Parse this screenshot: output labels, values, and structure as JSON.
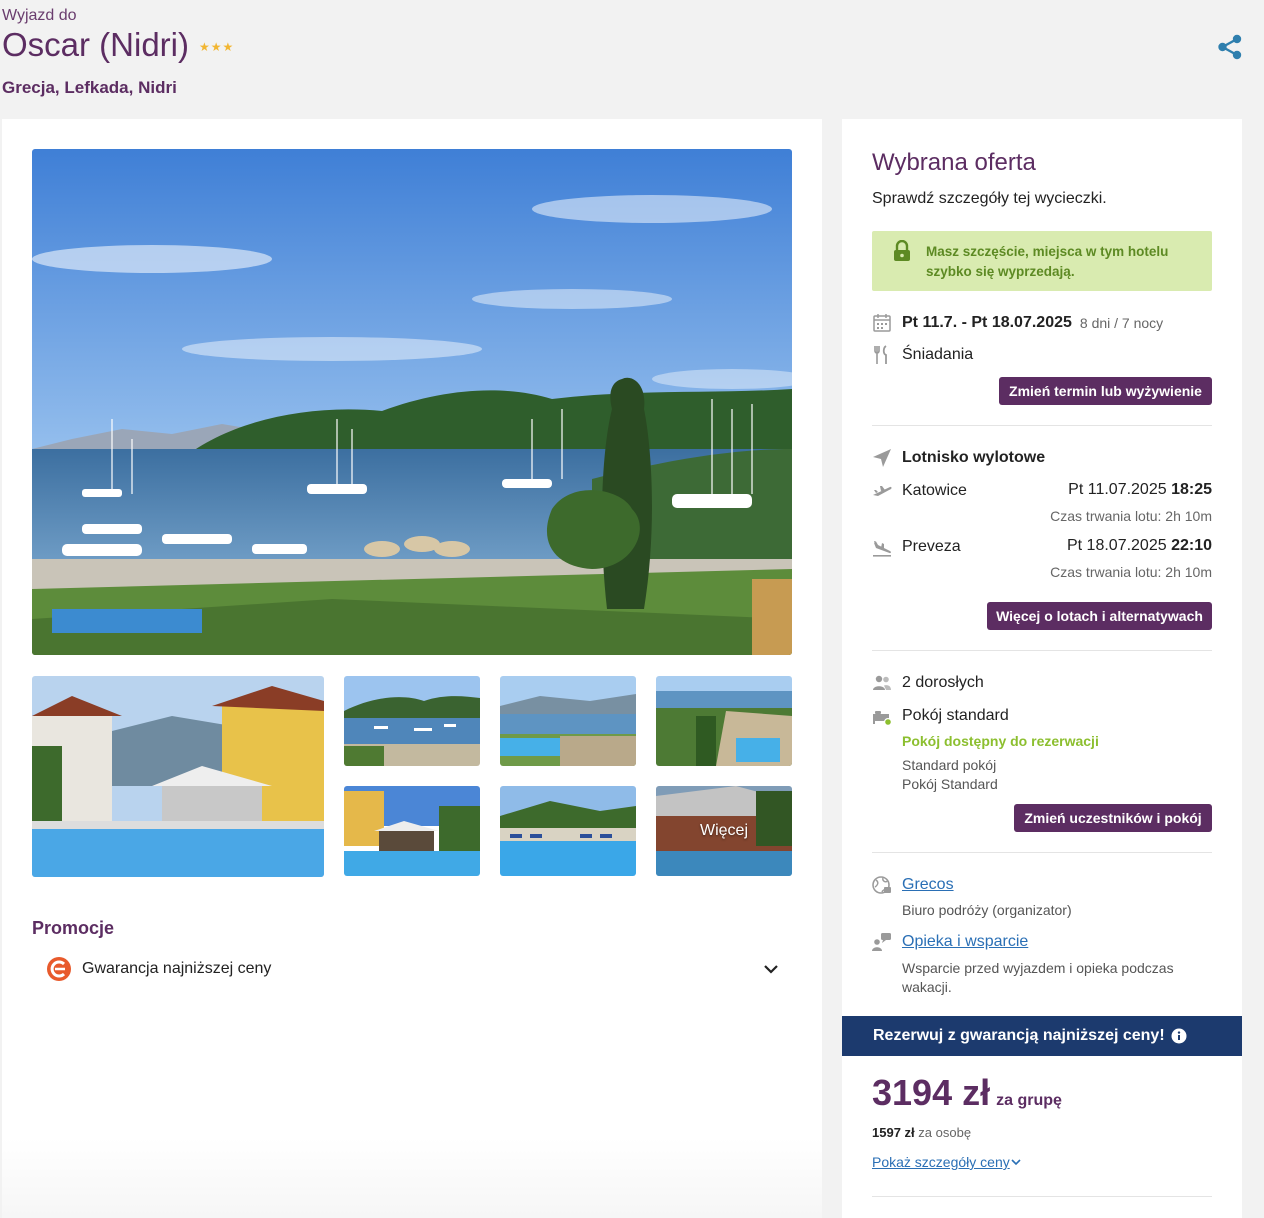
{
  "header": {
    "pre_title": "Wyjazd do",
    "title": "Oscar (Nidri)",
    "stars": "★★★",
    "location": "Grecja, Lefkada, Nidri"
  },
  "gallery": {
    "more_label": "Więcej"
  },
  "promotions": {
    "title": "Promocje",
    "items": [
      {
        "label": "Gwarancja najniższej ceny"
      }
    ]
  },
  "offer": {
    "title": "Wybrana oferta",
    "subtitle": "Sprawdź szczegóły tej wycieczki.",
    "alert": "Masz szczęście, miejsca w tym hotelu szybko się wyprzedają.",
    "dates": "Pt 11.7. - Pt 18.07.2025",
    "duration": "8 dni / 7 nocy",
    "meal": "Śniadania",
    "change_date_button": "Zmień termin lub wyżywienie",
    "airport_label": "Lotnisko wylotowe",
    "outbound": {
      "city": "Katowice",
      "date": "Pt 11.07.2025",
      "time": "18:25",
      "duration": "Czas trwania lotu: 2h 10m"
    },
    "return": {
      "city": "Preveza",
      "date": "Pt 18.07.2025",
      "time": "22:10",
      "duration": "Czas trwania lotu: 2h 10m"
    },
    "flights_button": "Więcej o lotach i alternatywach",
    "travellers": "2 dorosłych",
    "room": "Pokój standard",
    "room_status": "Pokój dostępny do rezerwacji",
    "room_detail_1": "Standard pokój",
    "room_detail_2": "Pokój Standard",
    "change_participants_button": "Zmień uczestników i pokój",
    "organizer_link": "Grecos",
    "organizer_desc": "Biuro podróży (organizator)",
    "support_link": "Opieka i wsparcie",
    "support_desc": "Wsparcie przed wyjazdem i opieka podczas wakacji."
  },
  "booking": {
    "band_text": "Rezerwuj z gwarancją najniższej ceny!",
    "price": "3194 zł",
    "price_unit": "za grupę",
    "per_person_price": "1597 zł",
    "per_person_label": "za osobę",
    "show_details": "Pokaż szczegóły ceny"
  },
  "colors": {
    "brand_purple": "#5c2d62",
    "alert_green_bg": "#d9ebb0",
    "status_green": "#8cbf2f",
    "band_navy": "#1c3a6e",
    "link_blue": "#2a6fb5",
    "star_gold": "#f2b632"
  },
  "icons": [
    "share-icon",
    "lock-icon",
    "calendar-icon",
    "cutlery-icon",
    "plane-icon",
    "takeoff-icon",
    "landing-icon",
    "people-icon",
    "bed-icon",
    "globe-icon",
    "support-icon",
    "info-icon",
    "chevron-down-icon",
    "promo-logo-icon"
  ]
}
